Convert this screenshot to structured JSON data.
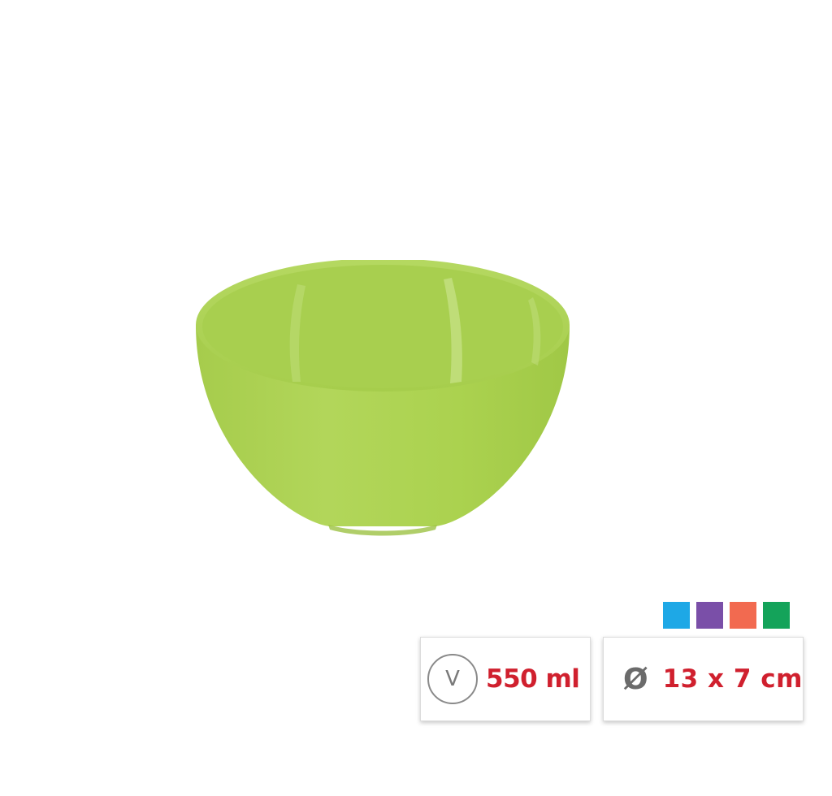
{
  "product": {
    "image": "green-plastic-bowl",
    "color": "#a9d150"
  },
  "colors": [
    {
      "name": "blue",
      "hex": "#1ea8e6"
    },
    {
      "name": "purple",
      "hex": "#7a4fa8"
    },
    {
      "name": "orange",
      "hex": "#f26a50"
    },
    {
      "name": "green",
      "hex": "#14a35a"
    }
  ],
  "volume": {
    "icon_label": "V",
    "value": "550 ml"
  },
  "dimensions": {
    "icon_label": "Ø",
    "value": "13 x 7 cm"
  }
}
